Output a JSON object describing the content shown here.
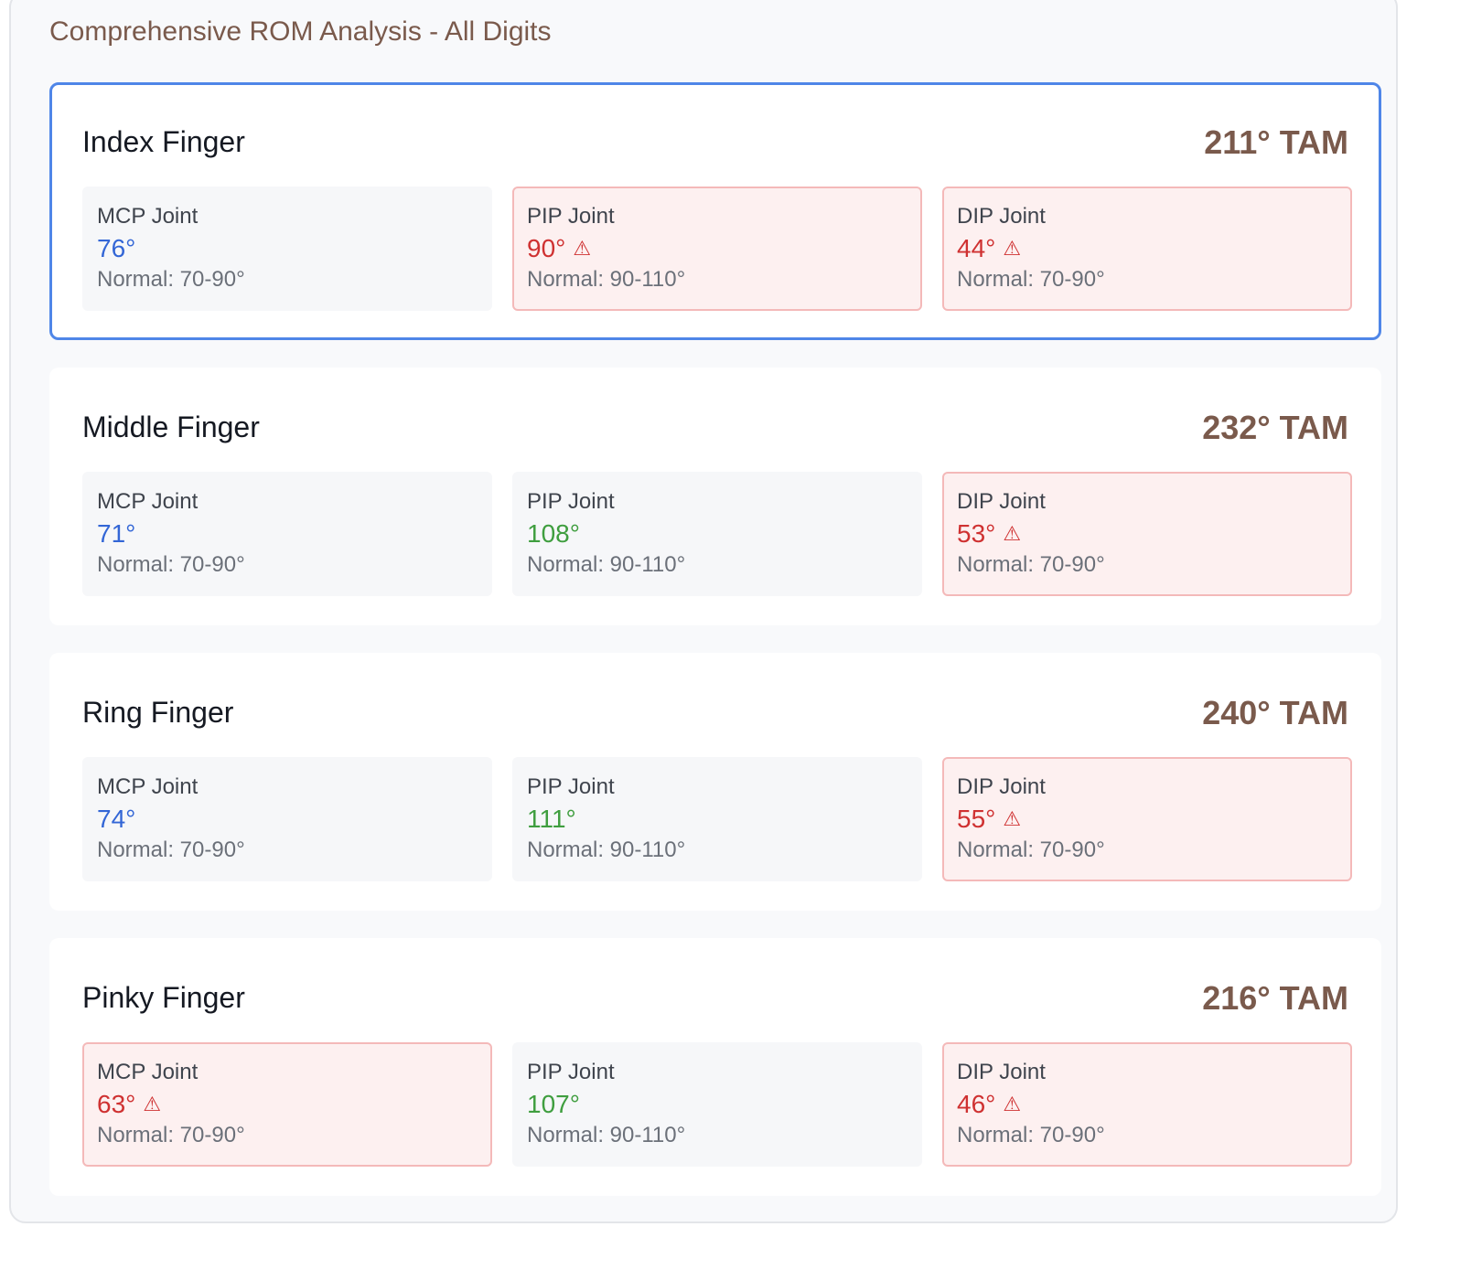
{
  "panel": {
    "title": "Comprehensive ROM Analysis - All Digits"
  },
  "colors": {
    "accent_brown": "#7a5a4c",
    "selected_border": "#4f86e8",
    "value_blue": "#3366d6",
    "value_green": "#3f9e3f",
    "value_red": "#cf3131",
    "warning_background": "#fdf0f0",
    "warning_border": "#f4b9b9"
  },
  "fingers": [
    {
      "name": "Index Finger",
      "tam": "211° TAM",
      "selected": true,
      "joints": [
        {
          "label": "MCP Joint",
          "value": "76°",
          "normal": "Normal: 70-90°",
          "status": "blue",
          "warning": false
        },
        {
          "label": "PIP Joint",
          "value": "90°",
          "normal": "Normal: 90-110°",
          "status": "red",
          "warning": true,
          "icon": "warning-icon",
          "icon_glyph": "⚠"
        },
        {
          "label": "DIP Joint",
          "value": "44°",
          "normal": "Normal: 70-90°",
          "status": "red",
          "warning": true,
          "icon": "warning-icon",
          "icon_glyph": "⚠"
        }
      ]
    },
    {
      "name": "Middle Finger",
      "tam": "232° TAM",
      "selected": false,
      "joints": [
        {
          "label": "MCP Joint",
          "value": "71°",
          "normal": "Normal: 70-90°",
          "status": "blue",
          "warning": false
        },
        {
          "label": "PIP Joint",
          "value": "108°",
          "normal": "Normal: 90-110°",
          "status": "green",
          "warning": false
        },
        {
          "label": "DIP Joint",
          "value": "53°",
          "normal": "Normal: 70-90°",
          "status": "red",
          "warning": true,
          "icon": "warning-icon",
          "icon_glyph": "⚠"
        }
      ]
    },
    {
      "name": "Ring Finger",
      "tam": "240° TAM",
      "selected": false,
      "joints": [
        {
          "label": "MCP Joint",
          "value": "74°",
          "normal": "Normal: 70-90°",
          "status": "blue",
          "warning": false
        },
        {
          "label": "PIP Joint",
          "value": "111°",
          "normal": "Normal: 90-110°",
          "status": "green",
          "warning": false
        },
        {
          "label": "DIP Joint",
          "value": "55°",
          "normal": "Normal: 70-90°",
          "status": "red",
          "warning": true,
          "icon": "warning-icon",
          "icon_glyph": "⚠"
        }
      ]
    },
    {
      "name": "Pinky Finger",
      "tam": "216° TAM",
      "selected": false,
      "joints": [
        {
          "label": "MCP Joint",
          "value": "63°",
          "normal": "Normal: 70-90°",
          "status": "red",
          "warning": true,
          "icon": "warning-icon",
          "icon_glyph": "⚠"
        },
        {
          "label": "PIP Joint",
          "value": "107°",
          "normal": "Normal: 90-110°",
          "status": "green",
          "warning": false
        },
        {
          "label": "DIP Joint",
          "value": "46°",
          "normal": "Normal: 70-90°",
          "status": "red",
          "warning": true,
          "icon": "warning-icon",
          "icon_glyph": "⚠"
        }
      ]
    }
  ]
}
